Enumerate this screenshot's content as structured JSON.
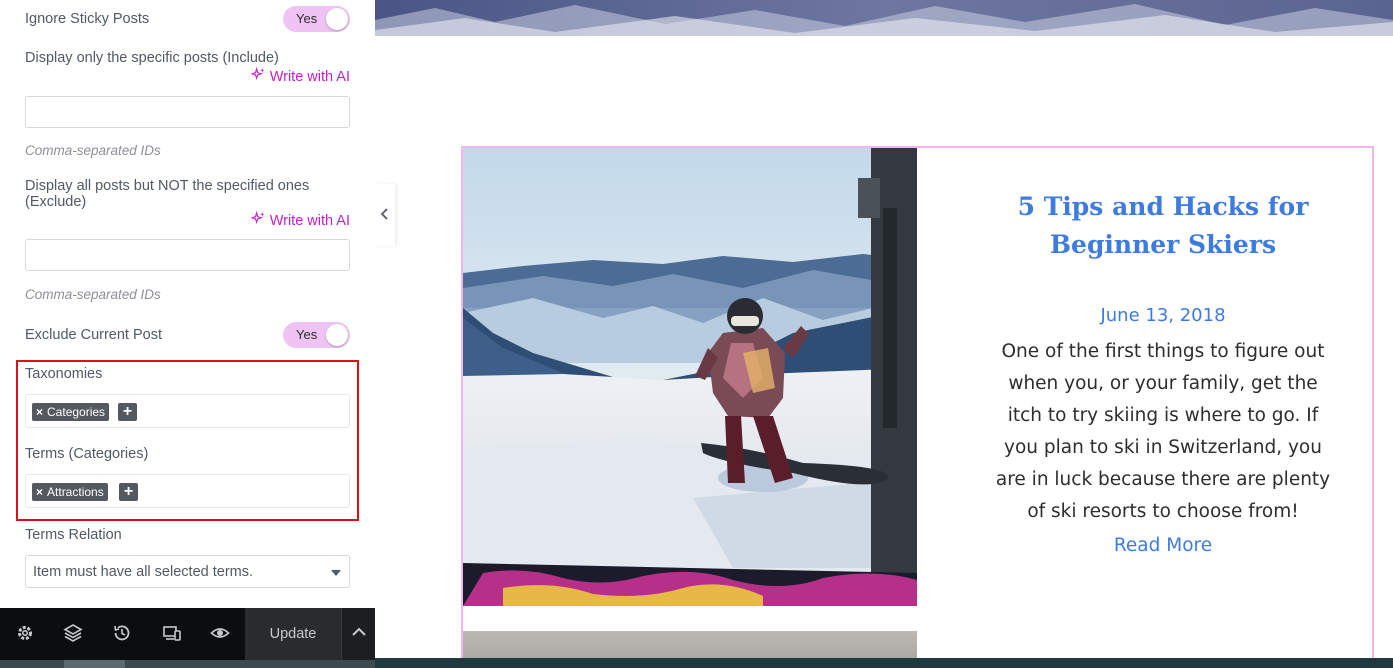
{
  "panel": {
    "ignore_sticky": {
      "label": "Ignore Sticky Posts",
      "toggle": "Yes"
    },
    "include": {
      "label": "Display only the specific posts (Include)",
      "ai_label": "Write with AI",
      "value": "",
      "hint": "Comma-separated IDs"
    },
    "exclude": {
      "label": "Display all posts but NOT the specified ones (Exclude)",
      "ai_label": "Write with AI",
      "value": "",
      "hint": "Comma-separated IDs"
    },
    "exclude_current": {
      "label": "Exclude Current Post",
      "toggle": "Yes"
    },
    "taxonomies": {
      "label": "Taxonomies",
      "tags": [
        "Categories"
      ],
      "remove_glyph": "×",
      "add_glyph": "+"
    },
    "terms": {
      "label": "Terms (Categories)",
      "tags": [
        "Attractions"
      ],
      "remove_glyph": "×",
      "add_glyph": "+"
    },
    "terms_relation": {
      "label": "Terms Relation",
      "selected": "Item must have all selected terms."
    },
    "accent_color": "#c41ec4",
    "highlight_color": "#e0101b"
  },
  "toolbar": {
    "icons": [
      "gear-icon",
      "layers-icon",
      "history-icon",
      "responsive-icon",
      "eye-icon"
    ],
    "update_label": "Update"
  },
  "post": {
    "title": "5 Tips and Hacks for Beginner Skiers",
    "date": "June 13, 2018",
    "excerpt": "One of the first things to figure out when you, or your family, get the itch to try skiing is where to go. If you plan to ski in Switzerland, you are in luck because there are plenty of ski resorts to choose from!",
    "read_more": "Read More",
    "link_color": "#3d7be0",
    "card_border_color": "#f0b6f2"
  }
}
